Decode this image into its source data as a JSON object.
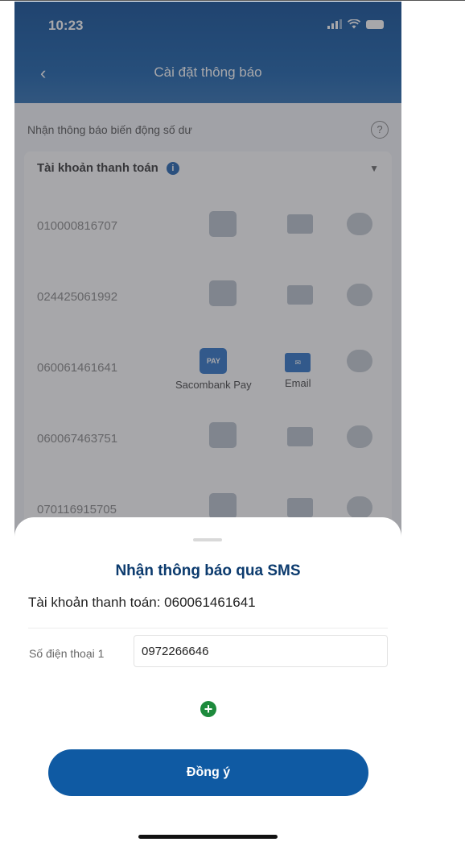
{
  "status_bar": {
    "time": "10:23"
  },
  "header": {
    "title": "Cài đặt thông báo"
  },
  "balance_section": {
    "label": "Nhận thông báo biến động số dư"
  },
  "account_type": {
    "label": "Tài khoản thanh toán"
  },
  "accounts": [
    {
      "number": "010000816707"
    },
    {
      "number": "024425061992"
    },
    {
      "number": "060061461641"
    },
    {
      "number": "060067463751"
    },
    {
      "number": "070116915705"
    }
  ],
  "channels": {
    "pay_icon_text": "PAY",
    "socombank_pay": "Sacombank Pay",
    "email": "Email"
  },
  "sheet": {
    "title": "Nhận thông báo qua SMS",
    "account_line": "Tài khoản thanh toán: 060061461641",
    "phone_label": "Số điện thoại 1",
    "phone_value": "0972266646",
    "add_symbol": "+",
    "agree_label": "Đồng ý"
  },
  "colors": {
    "primary": "#0f5aa3",
    "title": "#0c3b6e",
    "add": "#1d8a3c"
  }
}
